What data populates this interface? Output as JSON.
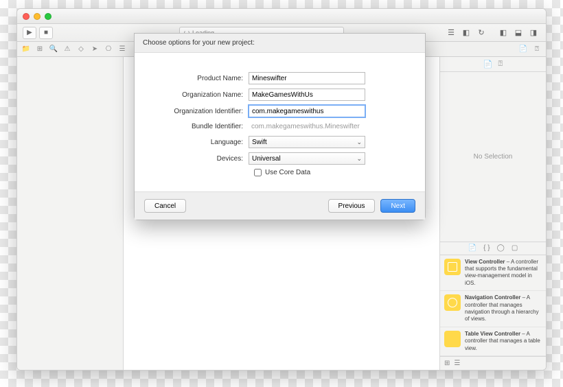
{
  "toolbar": {
    "loading_label": "Loading"
  },
  "inspector": {
    "no_selection": "No Selection"
  },
  "library": [
    {
      "title": "View Controller",
      "desc": " – A controller that supports the fundamental view-management model in iOS."
    },
    {
      "title": "Navigation Controller",
      "desc": " – A controller that manages navigation through a hierarchy of views."
    },
    {
      "title": "Table View Controller",
      "desc": " – A controller that manages a table view."
    }
  ],
  "sheet": {
    "heading": "Choose options for your new project:",
    "labels": {
      "product_name": "Product Name:",
      "org_name": "Organization Name:",
      "org_id": "Organization Identifier:",
      "bundle_id": "Bundle Identifier:",
      "language": "Language:",
      "devices": "Devices:",
      "core_data": "Use Core Data"
    },
    "values": {
      "product_name": "Mineswifter",
      "org_name": "MakeGamesWithUs",
      "org_id": "com.makegameswithus",
      "bundle_id": "com.makegameswithus.Mineswifter",
      "language": "Swift",
      "devices": "Universal"
    },
    "buttons": {
      "cancel": "Cancel",
      "previous": "Previous",
      "next": "Next"
    }
  }
}
